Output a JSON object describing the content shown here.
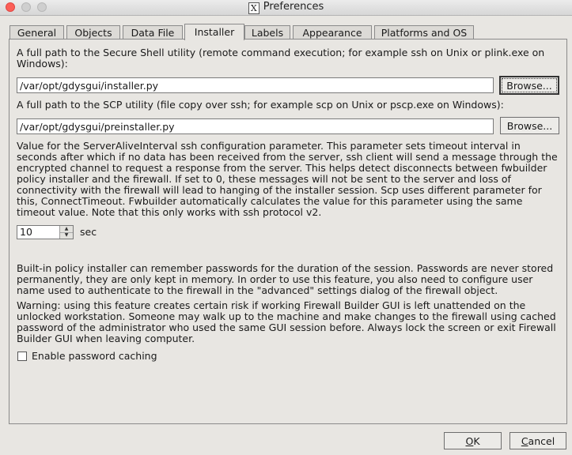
{
  "window": {
    "title": "Preferences",
    "app_icon": "x11-icon"
  },
  "tabs": [
    {
      "label": "General"
    },
    {
      "label": "Objects"
    },
    {
      "label": "Data File"
    },
    {
      "label": "Installer",
      "active": true
    },
    {
      "label": "Labels"
    },
    {
      "label": "Appearance"
    },
    {
      "label": "Platforms and OS"
    }
  ],
  "installer": {
    "ssh_description_line1": "A full path to the Secure Shell utility (remote command execution; for example ssh on Unix or plink.exe  on",
    "ssh_description_line2": "Windows):",
    "ssh_path": "/var/opt/gdysgui/installer.py",
    "scp_description": "A full path to the SCP utility (file copy over ssh; for example scp on Unix or pscp.exe on Windows):",
    "scp_path": "/var/opt/gdysgui/preinstaller.py",
    "browse_label": "Browse...",
    "keepalive_lines": [
      "Value for the ServerAliveInterval ssh configuration parameter. This parameter sets timeout interval in",
      "seconds after which if no data has been received from the server, ssh client will send a message through the",
      "encrypted channel to request a response from the server. This helps detect disconnects between fwbuilder",
      "policy installer and the firewall. If set to 0, these messages will not be sent to the server and loss of",
      "connectivity with the firewall will lead to hanging of the installer session. Scp uses different parameter for",
      "this, ConnectTimeout. Fwbuilder automatically calculates the value for this parameter using the same",
      "timeout value. Note that this only works with ssh protocol v2."
    ],
    "timeout_value": "10",
    "timeout_unit": "sec",
    "password_lines": [
      "Built-in policy installer can remember passwords for the duration of the session. Passwords are never stored",
      "permanently, they are only kept in memory. In order to use this feature, you also need to configure user",
      "name used to authenticate to the firewall in the \"advanced\" settings dialog of the firewall object."
    ],
    "warning_lines": [
      "Warning: using this feature creates certain risk if working Firewall Builder GUI is left unattended on the",
      "unlocked workstation. Someone may walk up to the machine and make changes to the firewall using cached",
      "password of the administrator who used the same GUI session before. Always lock the screen or exit Firewall",
      "Builder GUI when leaving computer."
    ],
    "password_caching_label": "Enable password caching",
    "password_caching_checked": false
  },
  "buttons": {
    "ok_mnemonic": "O",
    "ok_rest": "K",
    "cancel_mnemonic": "C",
    "cancel_rest": "ancel"
  }
}
